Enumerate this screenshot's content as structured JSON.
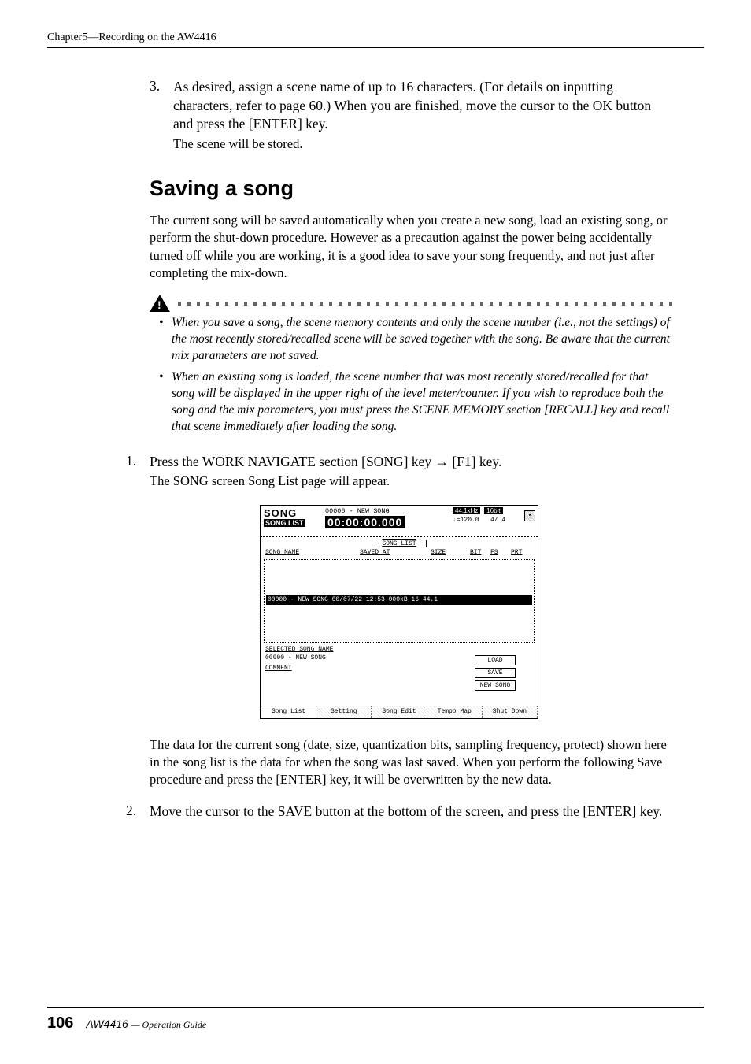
{
  "header": {
    "chapter": "Chapter5—Recording on the AW4416"
  },
  "step3": {
    "num": "3.",
    "text": "As desired, assign a scene name of up to 16 characters. (For details on inputting characters, refer to page 60.) When you are finished, move the cursor to the OK button and press the [ENTER] key.",
    "note": "The scene will be stored."
  },
  "section_title": "Saving a song",
  "intro_paragraph": "The current song will be saved automatically when you create a new song, load an existing song, or perform the shut-down procedure. However as a precaution against the power being accidentally turned off while you are working, it is a good idea to save your song frequently, and not just after completing the mix-down.",
  "warning": {
    "item1": "When you save a song, the scene memory contents and only the scene number (i.e., not the settings) of the most recently stored/recalled scene will be saved together with the song. Be aware that the current mix parameters are not saved.",
    "item2": "When an existing song is loaded, the scene number that was most recently stored/recalled for that song will be displayed in the upper right of the level meter/counter. If you wish to reproduce both the song and the mix parameters, you must press the SCENE MEMORY section [RECALL] key and recall that scene immediately after loading the song."
  },
  "step1": {
    "num": "1.",
    "text_a": "Press the WORK NAVIGATE section [SONG] key ",
    "arrow": "→",
    "text_b": " [F1] key.",
    "note": "The SONG screen Song List page will appear."
  },
  "screenshot": {
    "song_label": "SONG",
    "songlist_label": "SONG LIST",
    "title": "00000 - NEW SONG",
    "time": "00:00:00.000",
    "rate": "44.1kHz",
    "bits": "16bit",
    "tempo": "♩=120.0",
    "sig": "4/ 4",
    "list_header": "SONG LIST",
    "col_name": "SONG NAME",
    "col_saved": "SAVED AT",
    "col_size": "SIZE",
    "col_bit": "BIT",
    "col_fs": "FS",
    "col_prt": "PRT",
    "row": "00000 - NEW SONG  00/07/22 12:53   000kB 16 44.1",
    "selected_label": "SELECTED SONG NAME",
    "selected_value": "00000 - NEW SONG",
    "comment_label": "COMMENT",
    "btn_load": "LOAD",
    "btn_save": "SAVE",
    "btn_new": "NEW SONG",
    "tab1": "Song List",
    "tab2": "Setting",
    "tab3": "Song Edit",
    "tab4": "Tempo Map",
    "tab5": "Shut Down"
  },
  "after_screenshot": "The data for the current song (date, size, quantization bits, sampling frequency, protect) shown here in the song list is the data for when the song was last saved. When you perform the following Save procedure and press the [ENTER] key, it will be overwritten by the new data.",
  "step2": {
    "num": "2.",
    "text": "Move the cursor to the SAVE button at the bottom of the screen, and press the [ENTER] key."
  },
  "footer": {
    "page": "106",
    "logo": "AW4416",
    "guide": " — Operation Guide"
  }
}
